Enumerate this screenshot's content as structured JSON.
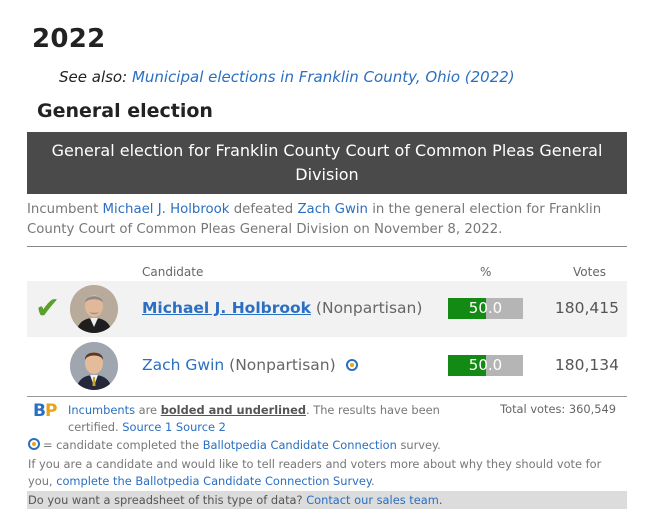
{
  "section": {
    "year": "2022",
    "see_also_prefix": "See also:",
    "see_also_link": "Municipal elections in Franklin County, Ohio (2022)",
    "heading": "General election"
  },
  "race": {
    "banner": "General election for Franklin County Court of Common Pleas General Division",
    "summary": {
      "prefix": "Incumbent",
      "winner_name": "Michael J. Holbrook",
      "verb": "defeated",
      "loser_name": "Zach Gwin",
      "suffix": "in the general election for Franklin County Court of Common Pleas General Division on November 8, 2022."
    },
    "columns": {
      "candidate": "Candidate",
      "percent": "%",
      "votes": "Votes"
    },
    "candidates": [
      {
        "name": "Michael J. Holbrook",
        "party": "(Nonpartisan)",
        "percent": "50.0",
        "pct_value": 50.0,
        "votes": "180,415",
        "winner": true,
        "connection": false
      },
      {
        "name": "Zach Gwin",
        "party": "(Nonpartisan)",
        "percent": "50.0",
        "pct_value": 50.0,
        "votes": "180,134",
        "winner": false,
        "connection": true
      }
    ],
    "total_votes": "Total votes: 360,549"
  },
  "footnotes": {
    "incumbents": "Incumbents",
    "are": "are",
    "bolded": "bolded and underlined",
    "results_text": ". The results have been certified.",
    "source1": "Source 1",
    "source2": "Source 2",
    "cc_text": "= candidate completed the",
    "cc_link": "Ballotpedia Candidate Connection",
    "cc_suffix": "survey.",
    "invite_text": "If you are a candidate and would like to tell readers and voters more about why they should vote for you,",
    "invite_link": "complete the Ballotpedia Candidate Connection Survey",
    "invite_end": ".",
    "spreadsheet_text": "Do you want a spreadsheet of this type of data?",
    "spreadsheet_link": "Contact our sales team",
    "spreadsheet_end": "."
  },
  "logo": {
    "b": "B",
    "p": "P"
  },
  "colors": {
    "link": "#2a6fc1",
    "banner": "#4a4a4a",
    "bar_fill": "#138a13",
    "bar_bg": "#b5b5b5",
    "check": "#5aa02c"
  }
}
